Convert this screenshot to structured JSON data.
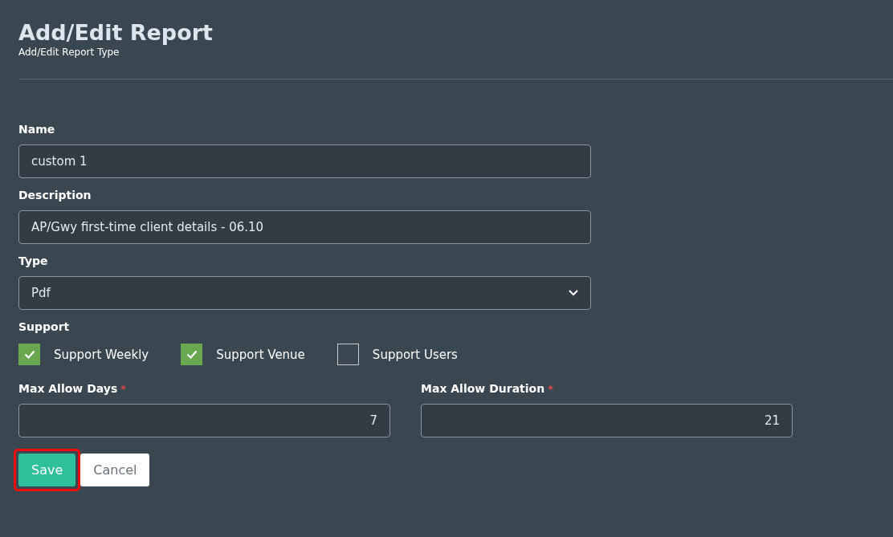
{
  "header": {
    "title": "Add/Edit Report",
    "subtitle": "Add/Edit Report Type"
  },
  "fields": [
    {
      "kind": "text",
      "label": "Name",
      "value": "custom 1"
    },
    {
      "kind": "text",
      "label": "Description",
      "value": "AP/Gwy first-time client details - 06.10"
    },
    {
      "kind": "select",
      "label": "Type",
      "value": "Pdf"
    }
  ],
  "support": {
    "label": "Support",
    "options": [
      {
        "label": "Support Weekly",
        "checked": true
      },
      {
        "label": "Support Venue",
        "checked": true
      },
      {
        "label": "Support Users",
        "checked": false
      }
    ]
  },
  "limits": [
    {
      "label": "Max Allow Days",
      "required_mark": "*",
      "value": "7"
    },
    {
      "label": "Max Allow Duration",
      "required_mark": "*",
      "value": "21"
    }
  ],
  "buttons": [
    {
      "kind": "primary",
      "label": "Save",
      "highlighted": true
    },
    {
      "kind": "secondary",
      "label": "Cancel",
      "highlighted": false
    }
  ]
}
